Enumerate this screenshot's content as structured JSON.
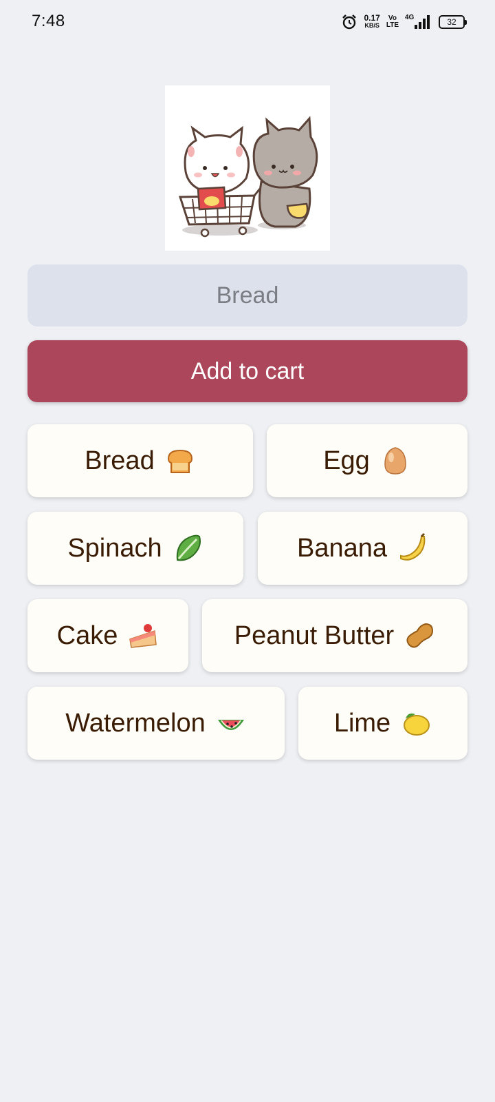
{
  "status_bar": {
    "time": "7:48",
    "net_speed_value": "0.17",
    "net_speed_unit": "KB/S",
    "volte_top": "Vo",
    "volte_bottom": "LTE",
    "network": "4G",
    "battery": "32"
  },
  "form": {
    "item_placeholder": "Bread",
    "add_button_label": "Add to cart"
  },
  "items": [
    {
      "label": "Bread",
      "icon": "bread-icon"
    },
    {
      "label": "Egg",
      "icon": "egg-icon"
    },
    {
      "label": "Spinach",
      "icon": "spinach-icon"
    },
    {
      "label": "Banana",
      "icon": "banana-icon"
    },
    {
      "label": "Cake",
      "icon": "cake-icon"
    },
    {
      "label": "Peanut Butter",
      "icon": "peanut-icon"
    },
    {
      "label": "Watermelon",
      "icon": "watermelon-icon"
    },
    {
      "label": "Lime",
      "icon": "lemon-icon"
    }
  ],
  "colors": {
    "background": "#eef0f4",
    "accent": "#ab465b",
    "input_fill": "#dde1eb",
    "chip_fill": "#fefdf8",
    "chip_text": "#3a1c04"
  }
}
